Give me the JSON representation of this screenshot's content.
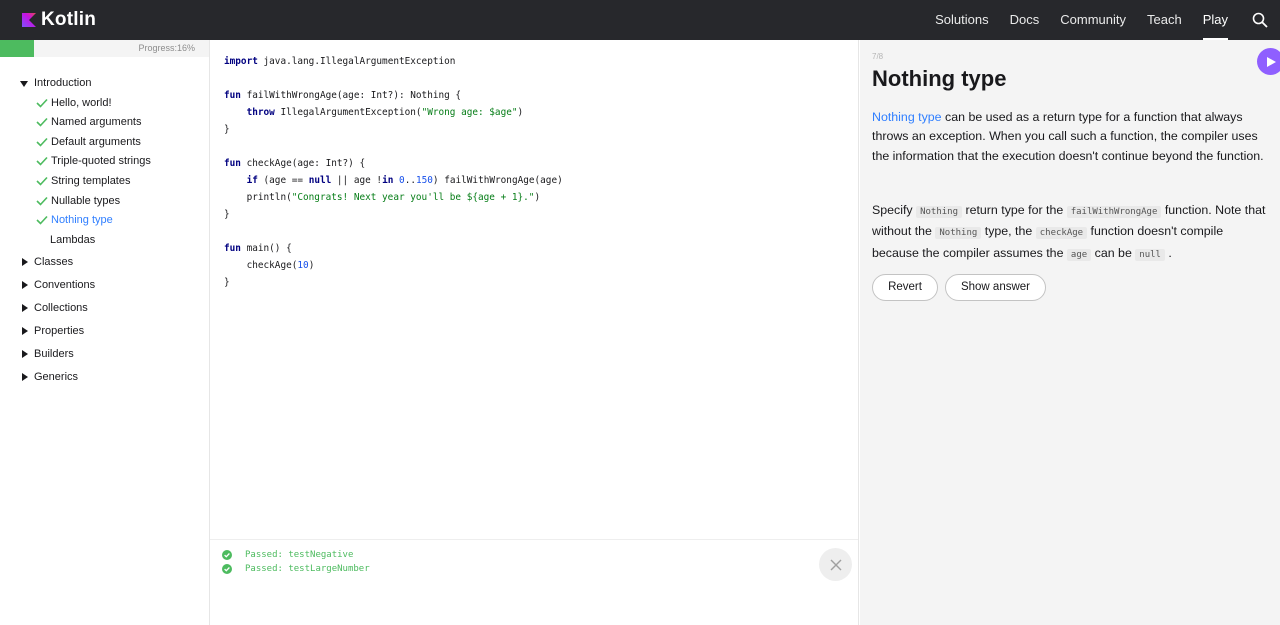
{
  "header": {
    "logo_text": "Kotlin",
    "nav": [
      "Solutions",
      "Docs",
      "Community",
      "Teach",
      "Play"
    ],
    "active_nav": "Play",
    "search_icon": "search-icon"
  },
  "sidebar": {
    "progress_label": "Progress:16%",
    "progress_value": 0.16,
    "intro_label": "Introduction",
    "intro_items": [
      {
        "label": "Hello, world!",
        "done": true
      },
      {
        "label": "Named arguments",
        "done": true
      },
      {
        "label": "Default arguments",
        "done": true
      },
      {
        "label": "Triple-quoted strings",
        "done": true
      },
      {
        "label": "String templates",
        "done": true
      },
      {
        "label": "Nullable types",
        "done": true
      },
      {
        "label": "Nothing type",
        "done": true,
        "current": true
      },
      {
        "label": "Lambdas",
        "done": false
      }
    ],
    "sections": [
      "Classes",
      "Conventions",
      "Collections",
      "Properties",
      "Builders",
      "Generics"
    ]
  },
  "code": {
    "import_kw": "import",
    "import_path": " java.lang.IllegalArgumentException",
    "f1_kw": "fun",
    "f1_sig": " failWithWrongAge(age: Int?): Nothing {",
    "f1_throw_kw": "throw",
    "f1_throw_pre": " IllegalArgumentException(",
    "f1_throw_str": "\"Wrong age: $age\"",
    "f1_throw_post": ")",
    "f1_close": "}",
    "f2_kw": "fun",
    "f2_sig": " checkAge(age: Int?) {",
    "f2_if_kw": "if",
    "f2_if_a": " (age == ",
    "f2_null_kw": "null",
    "f2_if_b": " || age !",
    "f2_in_kw": "in",
    "f2_if_c": " ",
    "f2_range_a": "0",
    "f2_range_dots": "..",
    "f2_range_b": "150",
    "f2_if_d": ") failWithWrongAge(age)",
    "f2_println_pre": "println(",
    "f2_println_str": "\"Congrats! Next year you'll be ${age + 1}.\"",
    "f2_println_post": ")",
    "f2_close": "}",
    "f3_kw": "fun",
    "f3_sig": " main() {",
    "f3_call_pre": "checkAge(",
    "f3_call_num": "10",
    "f3_call_post": ")",
    "f3_close": "}"
  },
  "console": {
    "lines": [
      "Passed: testNegative",
      "Passed: testLargeNumber"
    ]
  },
  "task": {
    "step": "7/8",
    "title": "Nothing type",
    "p1_link": "Nothing type",
    "p1_rest": " can be used as a return type for a function that always throws an exception. When you call such a function, the compiler uses the information that the execution doesn't continue beyond the function.",
    "p2_a": "Specify ",
    "p2_code1": "Nothing",
    "p2_b": " return type for the ",
    "p2_code2": "failWithWrongAge",
    "p2_c": " function. Note that without the ",
    "p2_code3": "Nothing",
    "p2_d": " type, the ",
    "p2_code4": "checkAge",
    "p2_e": " function doesn't compile because the compiler assumes the ",
    "p2_code5": "age",
    "p2_f": " can be ",
    "p2_code6": "null",
    "p2_g": " .",
    "revert_label": "Revert",
    "show_answer_label": "Show answer"
  },
  "colors": {
    "header_bg": "#27282c",
    "accent_green": "#4dbb5f",
    "link_blue": "#307fff",
    "run_purple": "#8f5fff"
  }
}
